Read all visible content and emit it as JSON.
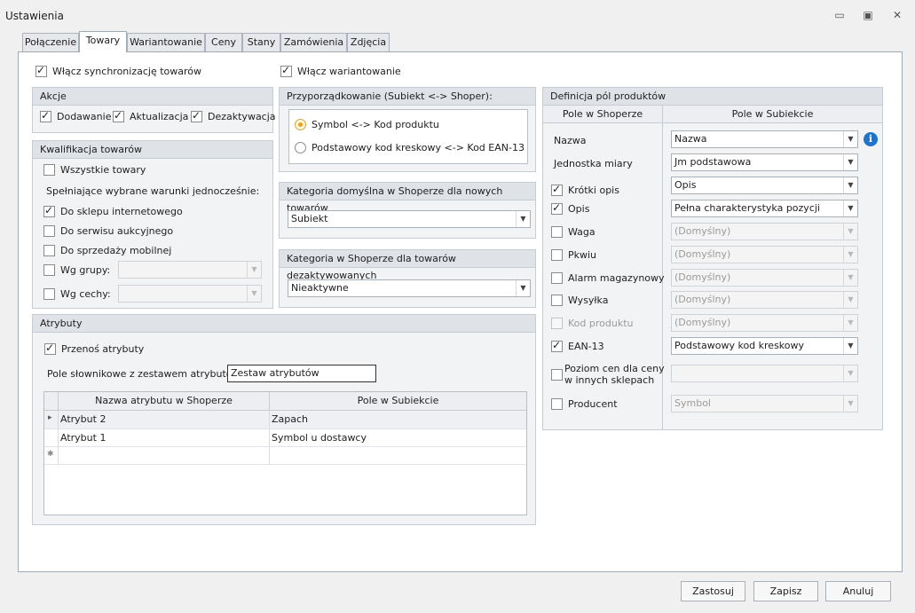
{
  "window": {
    "title": "Ustawienia",
    "min": "▭",
    "restore": "▣",
    "close": "✕"
  },
  "tabs": [
    "Połączenie",
    "Towary",
    "Wariantowanie",
    "Ceny",
    "Stany",
    "Zamówienia",
    "Zdjęcia"
  ],
  "top": {
    "sync_label": "Włącz synchronizację towarów",
    "variant_label": "Włącz wariantowanie"
  },
  "akcje": {
    "title": "Akcje",
    "add": "Dodawanie",
    "update": "Aktualizacja",
    "deact": "Dezaktywacja"
  },
  "kwal": {
    "title": "Kwalifikacja towarów",
    "all": "Wszystkie towary",
    "cond": "Spełniające wybrane warunki jednocześnie:",
    "shop": "Do sklepu internetowego",
    "auction": "Do serwisu aukcyjnego",
    "mobile": "Do sprzedaży mobilnej",
    "group": "Wg grupy:",
    "feature": "Wg cechy:"
  },
  "mapping": {
    "title": "Przyporządkowanie (Subiekt <-> Shoper):",
    "opt1": "Symbol <-> Kod produktu",
    "opt2": "Podstawowy kod kreskowy <-> Kod EAN-13"
  },
  "default_cat": {
    "title": "Kategoria domyślna w Shoperze dla nowych towarów",
    "value": "Subiekt"
  },
  "deact_cat": {
    "title": "Kategoria w Shoperze dla towarów dezaktywowanych",
    "value": "Nieaktywne"
  },
  "attrs": {
    "title": "Atrybuty",
    "transfer": "Przenoś atrybuty",
    "dict_label": "Pole słownikowe z zestawem atrybutów:",
    "dict_value": "Zestaw atrybutów",
    "col1": "Nazwa atrybutu w Shoperze",
    "col2": "Pole w Subiekcie",
    "rows": [
      {
        "a": "Atrybut 2",
        "b": "Zapach"
      },
      {
        "a": "Atrybut 1",
        "b": "Symbol u dostawcy"
      }
    ],
    "row_marker": "▸",
    "new_marker": "✱"
  },
  "fields": {
    "title": "Definicja pól produktów",
    "col1": "Pole w Shoperze",
    "col2": "Pole w Subiekcie",
    "nazwa_label": "Nazwa",
    "nazwa_value": "Nazwa",
    "jm_label": "Jednostka miary",
    "jm_value": "Jm podstawowa",
    "krotki_label": "Krótki opis",
    "krotki_value": "Opis",
    "opis_label": "Opis",
    "opis_value": "Pełna charakterystyka pozycji",
    "waga_label": "Waga",
    "waga_value": "(Domyślny)",
    "pkwiu_label": "Pkwiu",
    "pkwiu_value": "(Domyślny)",
    "alarm_label": "Alarm magazynowy",
    "alarm_value": "(Domyślny)",
    "wysylka_label": "Wysyłka",
    "wysylka_value": "(Domyślny)",
    "kod_label": "Kod produktu",
    "kod_value": "(Domyślny)",
    "ean_label": "EAN-13",
    "ean_value": "Podstawowy kod kreskowy",
    "poziom_label1": "Poziom cen dla ceny",
    "poziom_label2": "w innych sklepach",
    "poziom_value": "",
    "producent_label": "Producent",
    "producent_value": "Symbol",
    "info": "i"
  },
  "buttons": {
    "apply": "Zastosuj",
    "save": "Zapisz",
    "cancel": "Anuluj"
  },
  "colors": {
    "accent": "#1e74c8",
    "radio": "#e7a020"
  }
}
